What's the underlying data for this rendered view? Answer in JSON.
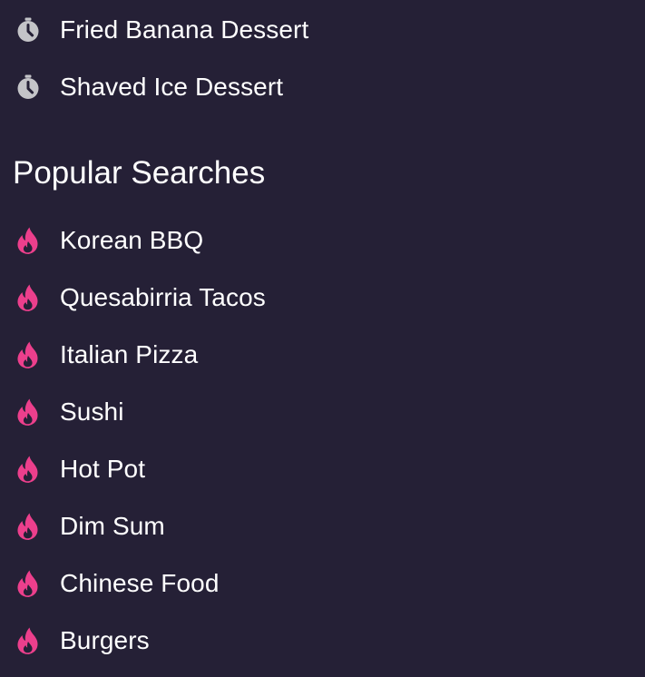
{
  "recent": {
    "icon": "clock-icon",
    "icon_color": "#c4c4c8",
    "items": [
      {
        "label": "Fried Banana Dessert"
      },
      {
        "label": "Shaved Ice Dessert"
      }
    ]
  },
  "popular": {
    "title": "Popular Searches",
    "icon": "fire-icon",
    "icon_color": "#ec3f8c",
    "items": [
      {
        "label": "Korean BBQ"
      },
      {
        "label": "Quesabirria Tacos"
      },
      {
        "label": "Italian Pizza"
      },
      {
        "label": "Sushi"
      },
      {
        "label": "Hot Pot"
      },
      {
        "label": "Dim Sum"
      },
      {
        "label": "Chinese Food"
      },
      {
        "label": "Burgers"
      }
    ]
  },
  "colors": {
    "background": "#252036",
    "text": "#ffffff"
  }
}
